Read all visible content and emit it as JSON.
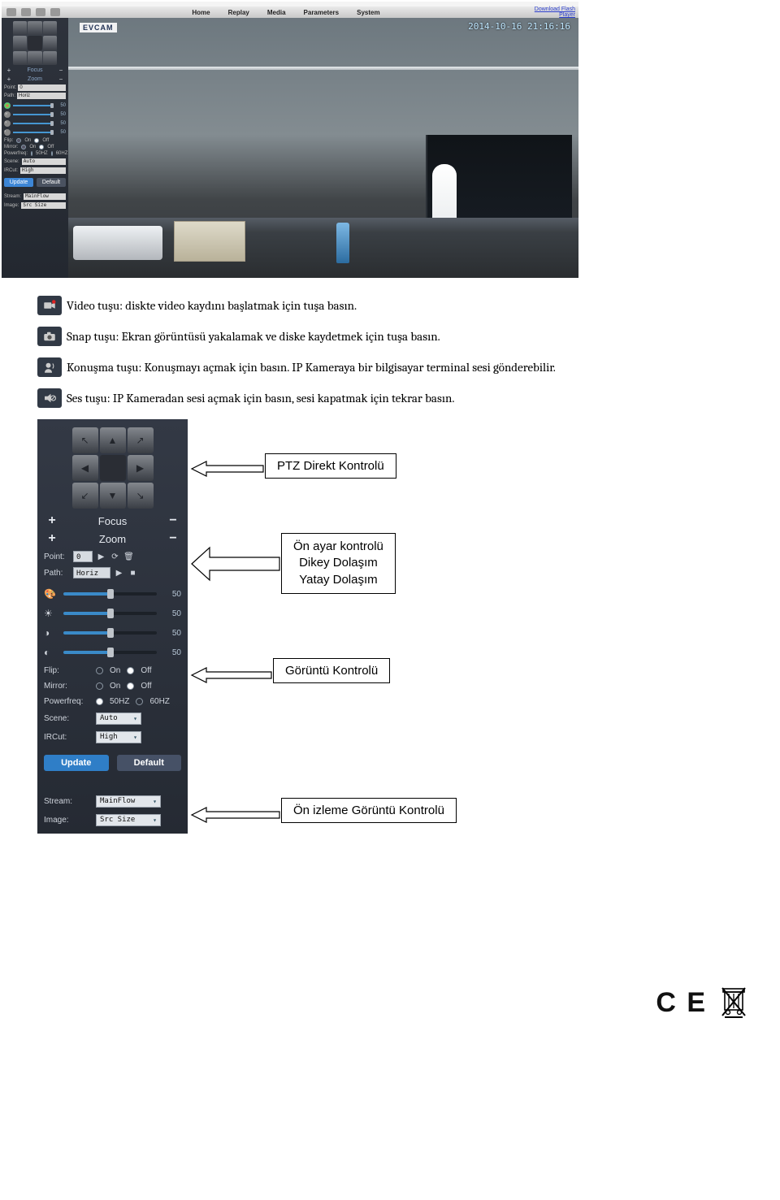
{
  "top_nav": {
    "items": [
      "Home",
      "Replay",
      "Media",
      "Parameters",
      "System"
    ],
    "download_link_line1": "Download Flash",
    "download_link_line2": "Player"
  },
  "video_overlay": {
    "logo": "EVCAM",
    "timestamp": "2014-10-16 21:16:16"
  },
  "side_small": {
    "focus_label": "Focus",
    "zoom_label": "Zoom",
    "point_label": "Point:",
    "point_value": "0",
    "path_label": "Path:",
    "path_value": "Horiz",
    "sliders": [
      {
        "value": "50"
      },
      {
        "value": "50"
      },
      {
        "value": "50"
      },
      {
        "value": "50"
      }
    ],
    "flip_label": "Flip:",
    "mirror_label": "Mirror:",
    "powerfreq_label": "Powerfreq:",
    "on_label": "On",
    "off_label": "Off",
    "hz50": "50HZ",
    "hz60": "60HZ",
    "scene_label": "Scene:",
    "scene_value": "Auto",
    "ircut_label": "IRCut:",
    "ircut_value": "High",
    "update_label": "Update",
    "default_label": "Default",
    "stream_label": "Stream:",
    "stream_value": "MainFlow",
    "image_label": "Image:",
    "image_value": "Src Size"
  },
  "descriptions": {
    "video": "Video tuşu: diskte video kaydını başlatmak için tuşa basın.",
    "snap": "Snap tuşu: Ekran görüntüsü yakalamak ve diske kaydetmek için tuşa basın.",
    "talk": " Konuşma tuşu: Konuşmayı açmak için basın. IP Kameraya bir bilgisayar terminal sesi gönderebilir.",
    "sound": "Ses tuşu: IP Kameradan sesi açmak için basın, sesi kapatmak için tekrar basın."
  },
  "side_large": {
    "focus_label": "Focus",
    "zoom_label": "Zoom",
    "point_label": "Point:",
    "point_value": "0",
    "path_label": "Path:",
    "path_value": "Horiz",
    "sliders": [
      {
        "value": "50"
      },
      {
        "value": "50"
      },
      {
        "value": "50"
      },
      {
        "value": "50"
      }
    ],
    "flip_label": "Flip:",
    "mirror_label": "Mirror:",
    "powerfreq_label": "Powerfreq:",
    "on_label": "On",
    "off_label": "Off",
    "hz50": "50HZ",
    "hz60": "60HZ",
    "scene_label": "Scene:",
    "scene_value": "Auto",
    "ircut_label": "IRCut:",
    "ircut_value": "High",
    "update_label": "Update",
    "default_label": "Default",
    "stream_label": "Stream:",
    "stream_value": "MainFlow",
    "image_label": "Image:",
    "image_value": "Src Size"
  },
  "callouts": {
    "ptz": "PTZ Direkt Kontrolü",
    "preset_line1": "Ön ayar kontrolü",
    "preset_line2": "Dikey Dolaşım",
    "preset_line3": "Yatay Dolaşım",
    "image_ctrl": "Görüntü Kontrolü",
    "preview_ctrl": "Ön izleme Görüntü Kontrolü"
  },
  "footer": {
    "ce": "C E"
  }
}
